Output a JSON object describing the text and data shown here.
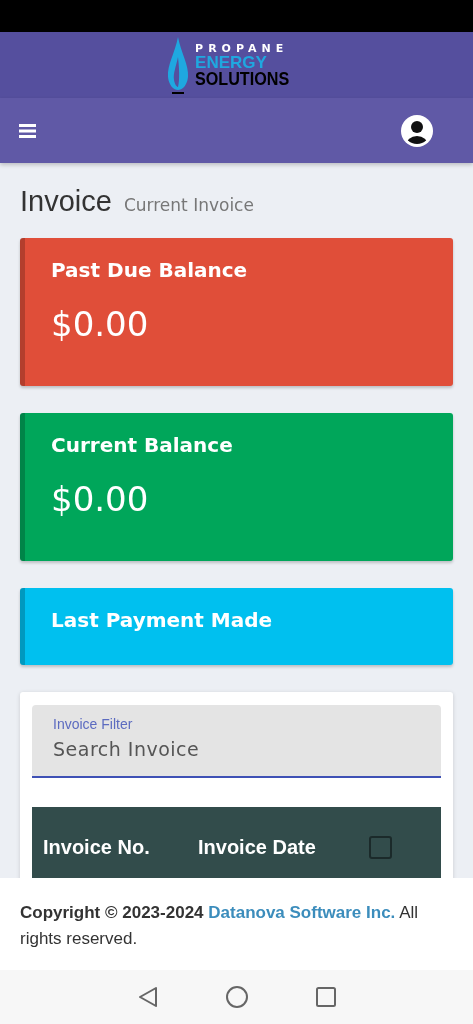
{
  "logo": {
    "line_1": "PROPANE",
    "line_2": "ENERGY",
    "line_3": "SOLUTIONS"
  },
  "page": {
    "title": "Invoice",
    "subtitle": "Current Invoice"
  },
  "cards": [
    {
      "label": "Past Due Balance",
      "amount": "$0.00",
      "color": "#e04e39"
    },
    {
      "label": "Current Balance",
      "amount": "$0.00",
      "color": "#00a65a"
    },
    {
      "label": "Last Payment Made",
      "color": "#00c0ef"
    }
  ],
  "filter": {
    "label": "Invoice Filter",
    "placeholder": "Search Invoice"
  },
  "table": {
    "columns": [
      "Invoice No.",
      "Invoice Date"
    ],
    "select_all": {
      "checked": false
    }
  },
  "footer": {
    "prefix": "**Copyright © 2023-2024**",
    "link": "Datanova Software Inc.",
    "suffix": "All rights reserved."
  }
}
